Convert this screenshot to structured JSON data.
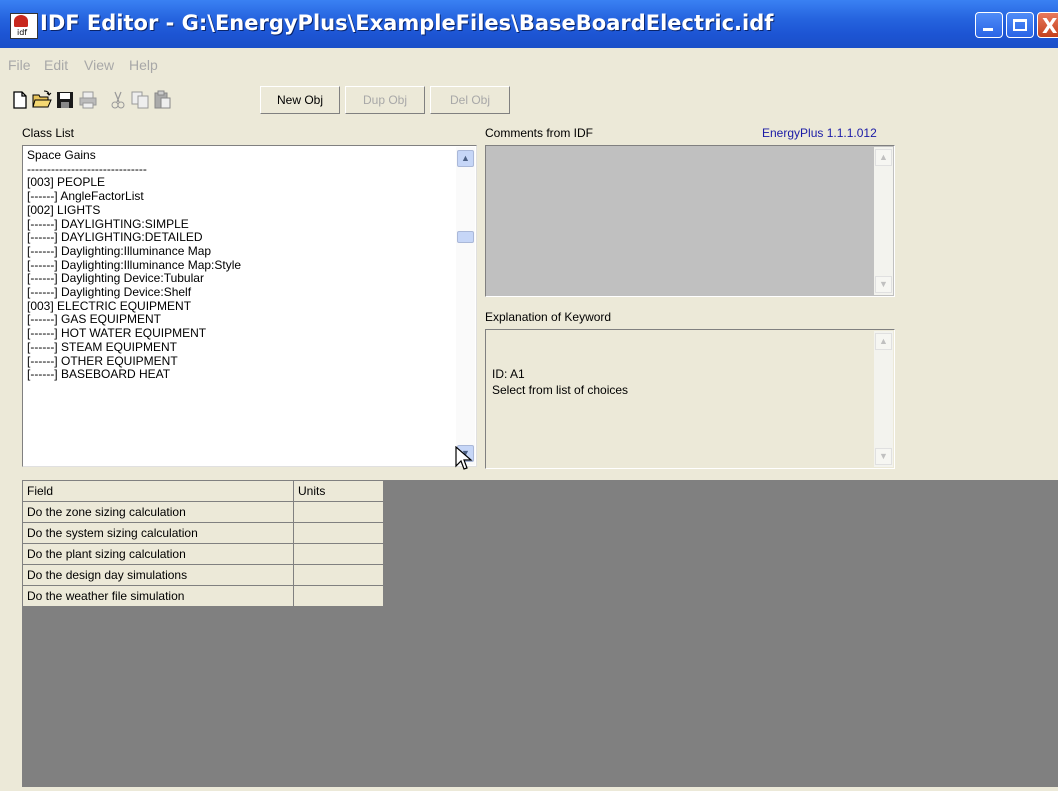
{
  "window": {
    "title": "IDF Editor - G:\\EnergyPlus\\ExampleFiles\\BaseBoardElectric.idf",
    "icon_text": "idf",
    "controls": {
      "minimize": "_",
      "maximize": "□",
      "close": "X"
    }
  },
  "menu": [
    "File",
    "Edit",
    "View",
    "Help"
  ],
  "toolbar": {
    "icons": [
      "new-file-icon",
      "open-folder-icon",
      "save-icon",
      "print-icon",
      "cut-icon",
      "copy-icon",
      "paste-icon"
    ],
    "new_obj": "New Obj",
    "dup_obj": "Dup Obj",
    "del_obj": "Del Obj"
  },
  "class_list": {
    "label": "Class List",
    "items": [
      "Space Gains",
      "------------------------------",
      "[003] PEOPLE",
      "[------] AngleFactorList",
      "[002] LIGHTS",
      "[------] DAYLIGHTING:SIMPLE",
      "[------] DAYLIGHTING:DETAILED",
      "[------] Daylighting:Illuminance Map",
      "[------] Daylighting:Illuminance Map:Style",
      "[------] Daylighting Device:Tubular",
      "[------] Daylighting Device:Shelf",
      "[003] ELECTRIC EQUIPMENT",
      "[------] GAS EQUIPMENT",
      "[------] HOT WATER EQUIPMENT",
      "[------] STEAM EQUIPMENT",
      "[------] OTHER EQUIPMENT",
      "[------] BASEBOARD HEAT"
    ]
  },
  "comments": {
    "label": "Comments from IDF"
  },
  "version": "EnergyPlus 1.1.1.012",
  "explanation": {
    "label": "Explanation of Keyword",
    "line1": "ID: A1",
    "line2": "Select from list of choices"
  },
  "grid": {
    "headers": [
      "Field",
      "Units"
    ],
    "rows": [
      "Do the zone sizing calculation",
      "Do the system sizing calculation",
      "Do the plant sizing calculation",
      "Do the design day simulations",
      "Do the weather file simulation"
    ]
  }
}
